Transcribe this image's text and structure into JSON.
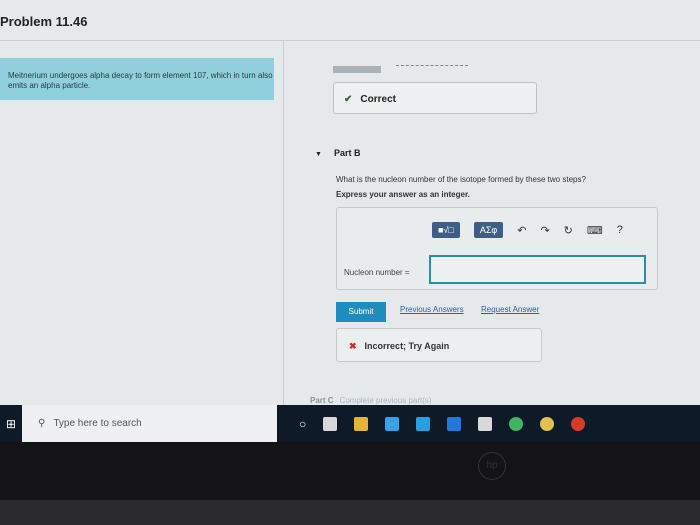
{
  "page": {
    "title": "Problem 11.46",
    "intro": "Meitnerium undergoes alpha decay to form element 107, which in turn also emits an alpha particle.",
    "correct_label": "Correct"
  },
  "partb": {
    "label": "Part B",
    "question": "What is the nucleon number of the isotope formed by these two steps?",
    "instruction": "Express your answer as an integer.",
    "toolbar": {
      "templates": "■√□",
      "symbols": "ΑΣφ",
      "help": "?"
    },
    "field_label": "Nucleon number =",
    "field_value": "",
    "submit": "Submit",
    "previous_answers": "Previous Answers",
    "request_answer": "Request Answer",
    "feedback": "Incorrect; Try Again"
  },
  "partc": {
    "label": "Part C",
    "status": "Complete previous part(s)"
  },
  "taskbar": {
    "search_placeholder": "Type here to search",
    "icon_colors": [
      "#d8d8d8",
      "#e8b23a",
      "#3aa0e8",
      "#28a0e0",
      "#2478d8",
      "#d8d8d8",
      "#3fb560",
      "#e0c050",
      "#d83a2a"
    ]
  },
  "device": {
    "logo": "hp"
  }
}
